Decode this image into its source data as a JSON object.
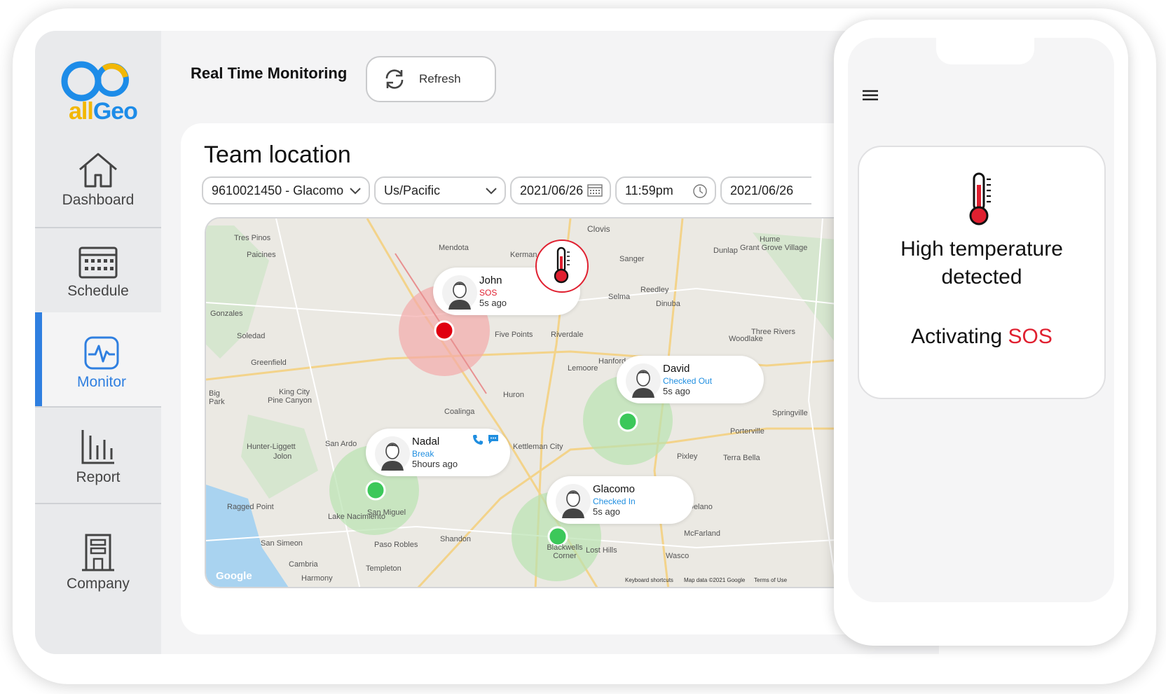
{
  "brand": {
    "logo_text_a": "all",
    "logo_text_b": "Geo"
  },
  "sidebar": {
    "items": [
      {
        "label": "Dashboard",
        "icon": "home-icon"
      },
      {
        "label": "Schedule",
        "icon": "calendar-icon"
      },
      {
        "label": "Monitor",
        "icon": "pulse-icon",
        "active": true
      },
      {
        "label": "Report",
        "icon": "bar-chart-icon"
      },
      {
        "label": "Company",
        "icon": "building-icon"
      }
    ]
  },
  "header": {
    "title": "Real Time Monitoring",
    "refresh_label": "Refresh"
  },
  "card": {
    "title": "Team location",
    "filters": {
      "employee": "9610021450 -  Glacomo",
      "timezone": "Us/Pacific",
      "date_from": "2021/06/26",
      "time_from": "11:59pm",
      "date_to": "2021/06/26"
    }
  },
  "map": {
    "places": [
      "Tres Pinos",
      "Paicines",
      "Mendota",
      "Kerman",
      "Clovis",
      "Sanger",
      "Dunlap",
      "Hume",
      "Grant Grove Village",
      "Reedley",
      "Selma",
      "Dinuba",
      "Five Points",
      "Riverdale",
      "Soledad",
      "Gonzales",
      "Greenfield",
      "Hanford",
      "Lemoore",
      "Woodlake",
      "Three Rivers",
      "King City",
      "Pine Canyon",
      "Huron",
      "Coalinga",
      "San Ardo",
      "Hunter-Liggett",
      "Jolon",
      "Kettleman City",
      "Pixley",
      "Porterville",
      "Terra Bella",
      "Springville",
      "Ragged Point",
      "Lake Nacimiento",
      "San Miguel",
      "San Simeon",
      "Paso Robles",
      "Shandon",
      "Blackwells Corner",
      "Lost Hills",
      "Wasco",
      "McFarland",
      "Delano",
      "Cambria",
      "Harmony",
      "Templeton",
      "Big Park"
    ],
    "attribution": {
      "google": "Google",
      "shortcuts": "Keyboard shortcuts",
      "mapdata": "Map data ©2021 Google",
      "terms": "Terms of Use"
    },
    "markers": [
      {
        "name": "John",
        "status": "SOS",
        "time": "5s ago",
        "status_color": "#e02030"
      },
      {
        "name": "David",
        "status": "Checked Out",
        "time": "5s ago",
        "status_color": "#1f8ee0"
      },
      {
        "name": "Nadal",
        "status": "Break",
        "time": "5hours ago",
        "status_color": "#1f8ee0"
      },
      {
        "name": "Glacomo",
        "status": "Checked In",
        "time": "5s ago",
        "status_color": "#1f8ee0"
      }
    ]
  },
  "phone": {
    "alert_line1": "High temperature",
    "alert_line2": "detected",
    "activating": "Activating",
    "sos": "SOS"
  },
  "colors": {
    "accent": "#2f7fe0",
    "sos": "#e02030",
    "ok": "#3cc85a"
  }
}
